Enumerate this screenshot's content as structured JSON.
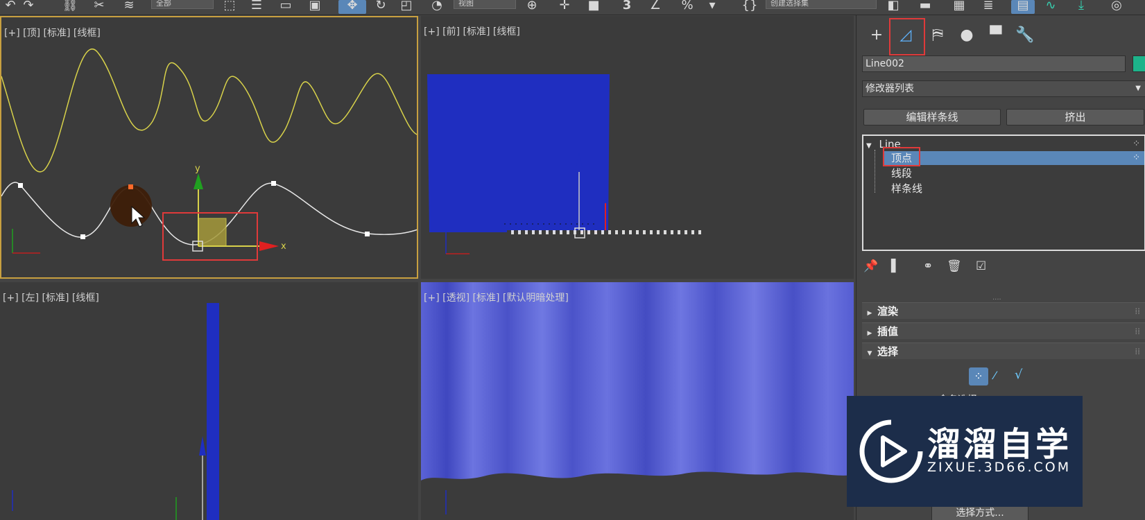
{
  "toolbar": {
    "dropdown_left": "全部",
    "dropdown_view": "视图",
    "number": "3",
    "percent": "%",
    "dropdown_selection_set": "创建选择集"
  },
  "viewports": {
    "top": {
      "label": "[+] [顶] [标准] [线框]",
      "axis_x": "x",
      "axis_y": "y"
    },
    "front": {
      "label": "[+] [前] [标准] [线框]"
    },
    "left": {
      "label": "[+] [左] [标准] [线框]"
    },
    "perspective": {
      "label": "[+] [透视] [标准] [默认明暗处理]"
    }
  },
  "panel": {
    "object_name": "Line002",
    "object_color": "#1db38a",
    "modifier_list": "修改器列表",
    "btn_edit_spline": "编辑样条线",
    "btn_extrude": "挤出",
    "stack": {
      "root": "Line",
      "vertex": "顶点",
      "segment": "线段",
      "spline": "样条线"
    },
    "rollouts": {
      "render": "渲染",
      "interpolation": "插值",
      "selection": "选择"
    },
    "selection_partial": "命名选择",
    "select_by": "选择方式..."
  },
  "watermark": {
    "title": "溜溜自学",
    "url": "ZIXUE.3D66.COM"
  },
  "colors": {
    "highlight_red": "#e03a3a",
    "selection_blue": "#5a87b8",
    "curtain_blue": "#1f2ec0",
    "perspective_blue": "#5b63d6"
  }
}
